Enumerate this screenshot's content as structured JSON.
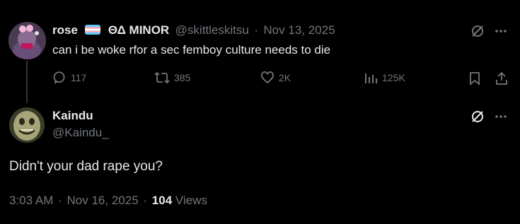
{
  "parent": {
    "name": "rose",
    "badge": "ΘΔ MINOR",
    "handle": "@skittleskitsu",
    "separator": "·",
    "date": "Nov 13, 2025",
    "text": "can i be woke rfor a sec femboy culture needs to die",
    "actions": {
      "replies": "117",
      "retweets": "385",
      "likes": "2K",
      "views": "125K"
    }
  },
  "reply": {
    "name": "Kaindu",
    "handle": "@Kaindu_",
    "text": "Didn't your dad rape you?",
    "time": "3:03 AM",
    "separator": "·",
    "date": "Nov 16, 2025",
    "views_count": "104",
    "views_label": "Views"
  },
  "icons": [
    "grok-icon",
    "more-icon",
    "reply-icon",
    "retweet-icon",
    "like-icon",
    "views-icon",
    "bookmark-icon",
    "share-icon"
  ],
  "colors": {
    "background": "#000000",
    "text": "#e7e9ea",
    "muted": "#71767b",
    "thread": "#333639"
  }
}
